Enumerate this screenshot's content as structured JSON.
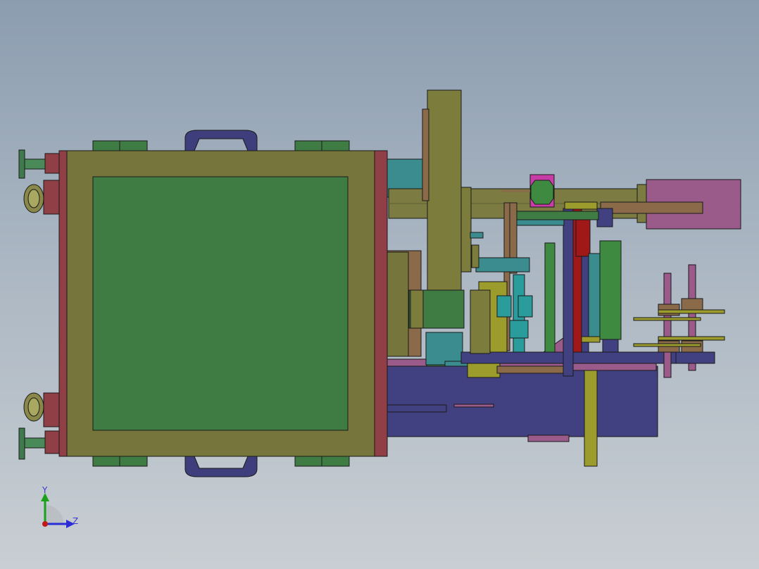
{
  "view": {
    "background_top": "#8c9db0",
    "background_bottom": "#c9ced3"
  },
  "triad": {
    "y_label": "Y",
    "z_label": "Z",
    "y_color": "#1aa01a",
    "z_color": "#2c2cd6",
    "origin_color": "#c01818"
  },
  "colors": {
    "frame": "#76753c",
    "panel": "#3f7c44",
    "red_plate": "#8f3f45",
    "handle": "#3e3e7c",
    "teal": "#3b8c8e",
    "olive": "#7c7c3c",
    "navy": "#414080",
    "purple": "#9a5a8a",
    "pink": "#a86898",
    "brown": "#8a6a48",
    "cylinder": "#7b7b42",
    "green": "#3e8a40",
    "cyan": "#2a9c9c",
    "yellow": "#9c9c2c",
    "magenta": "#c83ca8",
    "dark_red": "#a01818"
  }
}
